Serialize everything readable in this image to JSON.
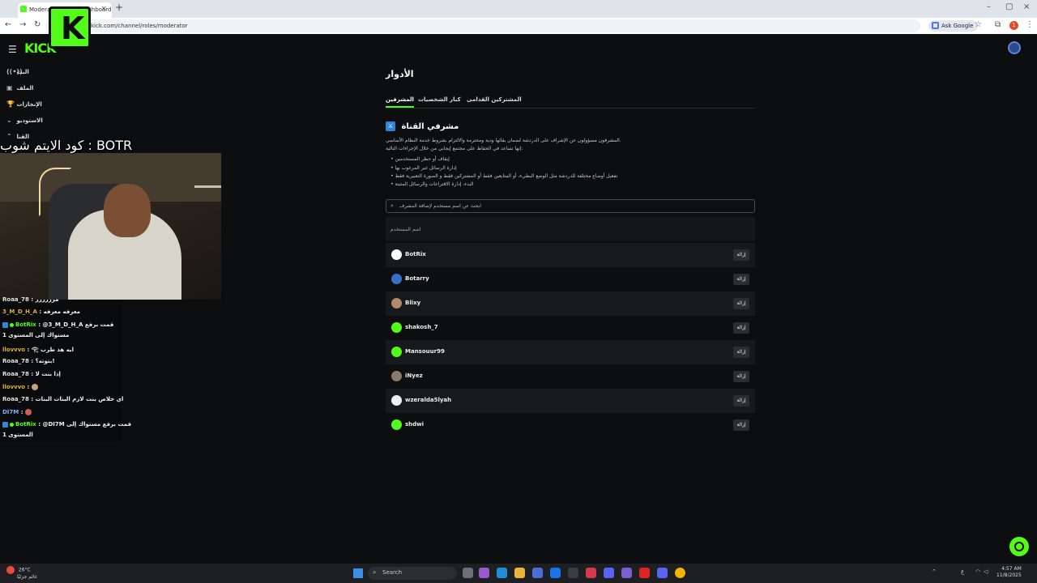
{
  "browser": {
    "tab_title": "Moderators - Kick Dashboard",
    "url": "kick.com/channel/roles/moderator",
    "ask_google": "Ask Google",
    "profile_initial": "1"
  },
  "kick": {
    "logo": "KICK",
    "sidebar": [
      {
        "icon": "((•))",
        "label": "البث"
      },
      {
        "icon": "▣",
        "label": "الملف"
      },
      {
        "icon": "🏆",
        "label": "الإنجازات"
      },
      {
        "icon": "⌄",
        "label": "الاستوديو"
      },
      {
        "icon": "⌃",
        "label": "القنا"
      }
    ]
  },
  "roles": {
    "title": "الأدوار",
    "tabs": [
      "المشرفين",
      "كبار الشخصيات",
      "المشتركين القدامى"
    ],
    "section_title": "مشرفي القناة",
    "description": [
      "المشرفون مسؤولون عن الإشراف على الدردشة لضمان بقائها ودية ومحترمة والالتزام بشروط خدمة النظام الأساسي.",
      "إنها تساعد في الحفاظ على مجتمع إيجابي من خلال الإجراءات التالية:"
    ],
    "bullets": [
      "إيقاف أو حظر المستخدمين",
      "إدارة الرسائل غير المرغوب بها",
      "تفعيل أوضاع مختلفة للدردشة مثل الوضع البطيء، أو المتابعين فقط أو المشتركين فقط و الصورة التعبيرية فقط",
      "البدء، إدارة الاقتراعات والرسائل المثبتة"
    ],
    "search_placeholder": "ابحث عن اسم مستخدم لإضافة المشرف",
    "table_header": "اسم المستخدم",
    "remove_label": "إزالة",
    "moderators": [
      {
        "name": "BotRix",
        "avatar_color": "#ffffff"
      },
      {
        "name": "Botarry",
        "avatar_color": "#3a6fc9"
      },
      {
        "name": "Blixy",
        "avatar_color": "#b08a6a"
      },
      {
        "name": "shakosh_7",
        "avatar_color": "#53fc18"
      },
      {
        "name": "Mansouur99",
        "avatar_color": "#53fc18"
      },
      {
        "name": "iNyez",
        "avatar_color": "#8a7a6a"
      },
      {
        "name": "wzeralda5lyah",
        "avatar_color": "#f0f0f0"
      },
      {
        "name": "shdwi",
        "avatar_color": "#53fc18"
      }
    ]
  },
  "overlay": {
    "code_text": "كود الايتم شوب : BOTR",
    "logo_letter": "K"
  },
  "chat": [
    {
      "user": "Roaa_78",
      "text": ": مرررررر",
      "color": "#e0e0e0"
    },
    {
      "user": "3_M_D_H_A",
      "text": ": معرفه معرفه",
      "color": "#d9b13a"
    },
    {
      "user": "BotRix",
      "text": ": @3_M_D_H_A قمت برفع",
      "color": "#53fc18",
      "badge": true
    },
    {
      "user": "",
      "text": "مستواك إلى المستوى 1",
      "color": "#e0e0e0"
    },
    {
      "user": "llovvvo",
      "text": ": 𓂀 ايه هذ طرب",
      "color": "#d9b13a"
    },
    {
      "user": "Roaa_78",
      "text": ": بتوته؟!",
      "color": "#e0e0e0"
    },
    {
      "user": "Roaa_78",
      "text": ": إذا بنت لا",
      "color": "#e0e0e0"
    },
    {
      "user": "llovvvo",
      "text": ":",
      "color": "#d9b13a",
      "emoji": true
    },
    {
      "user": "Roaa_78",
      "text": ": اي خلاص بنت لازم البنات البنات",
      "color": "#e0e0e0"
    },
    {
      "user": "DI7M",
      "text": ":",
      "color": "#7fb2ff",
      "emoji": true
    },
    {
      "user": "BotRix",
      "text": ": @DI7M قمت برفع مستواك إلى",
      "color": "#53fc18",
      "badge": true
    },
    {
      "user": "",
      "text": "المستوى 1",
      "color": "#e0e0e0"
    }
  ],
  "taskbar": {
    "weather_temp": "26°C",
    "weather_desc": "غائم جزئيًا",
    "search": "Search",
    "time": "4:57 AM",
    "date": "11/8/2025"
  },
  "colors": {
    "accent": "#53fc18",
    "bg": "#0d0e10"
  }
}
